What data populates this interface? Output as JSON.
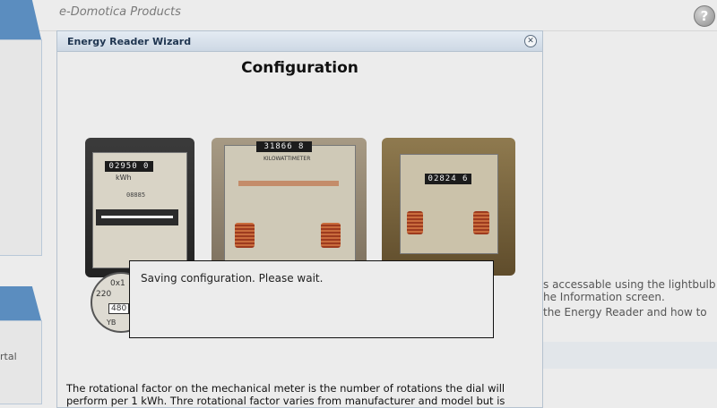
{
  "app": {
    "title": "e-Domotica Products",
    "help_label": "?"
  },
  "background": {
    "nav_label": "rtal",
    "text_lines": [
      "s accessable using the lightbulb",
      "he Information screen.",
      "the Energy Reader and how to"
    ]
  },
  "wizard": {
    "title": "Energy Reader Wizard",
    "close_icon": "close-icon",
    "heading": "Configuration",
    "meters": {
      "meter1": {
        "top_digits": "02950 0",
        "unit": "kWh",
        "lower_digits": "08885"
      },
      "meter2": {
        "top_digits": "31866 8",
        "label": "KILOWATTIMETER"
      },
      "meter3": {
        "top_digits": "02824 6"
      },
      "dial_readings": [
        "0x1",
        "220",
        "480",
        "YB"
      ]
    },
    "dialog": {
      "message": "Saving configuration. Please wait."
    },
    "description": "The rotational factor on the mechanical meter is the number of rotations the dial will perform per 1 kWh. Thre rotational factor varies from manufacturer and model but is"
  }
}
